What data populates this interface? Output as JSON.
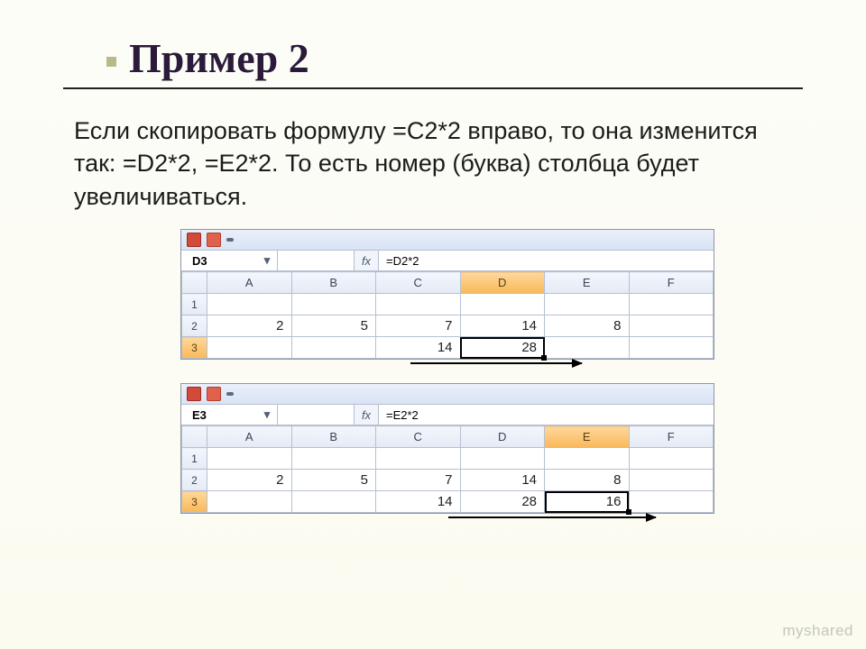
{
  "slide": {
    "title": "Пример 2",
    "body": "Если скопировать формулу =C2*2 вправо, то она изменится так: =D2*2, =E2*2. То есть номер (буква) столбца будет увеличиваться."
  },
  "excel1": {
    "nameBox": "D3",
    "fxLabel": "fx",
    "formula": "=D2*2",
    "columns": [
      "A",
      "B",
      "C",
      "D",
      "E",
      "F"
    ],
    "selectedCol": "D",
    "selectedRow": "3",
    "rows": [
      {
        "num": "1",
        "cells": [
          "",
          "",
          "",
          "",
          "",
          ""
        ],
        "sel": false
      },
      {
        "num": "2",
        "cells": [
          "2",
          "5",
          "7",
          "14",
          "8",
          ""
        ],
        "sel": false
      },
      {
        "num": "3",
        "cells": [
          "",
          "",
          "14",
          "28",
          "",
          ""
        ],
        "sel": true,
        "selIdx": 3
      }
    ]
  },
  "excel2": {
    "nameBox": "E3",
    "fxLabel": "fx",
    "formula": "=E2*2",
    "columns": [
      "A",
      "B",
      "C",
      "D",
      "E",
      "F"
    ],
    "selectedCol": "E",
    "selectedRow": "3",
    "rows": [
      {
        "num": "1",
        "cells": [
          "",
          "",
          "",
          "",
          "",
          ""
        ],
        "sel": false
      },
      {
        "num": "2",
        "cells": [
          "2",
          "5",
          "7",
          "14",
          "8",
          ""
        ],
        "sel": false
      },
      {
        "num": "3",
        "cells": [
          "",
          "",
          "14",
          "28",
          "16",
          ""
        ],
        "sel": true,
        "selIdx": 4
      }
    ]
  },
  "watermark": "myshared"
}
